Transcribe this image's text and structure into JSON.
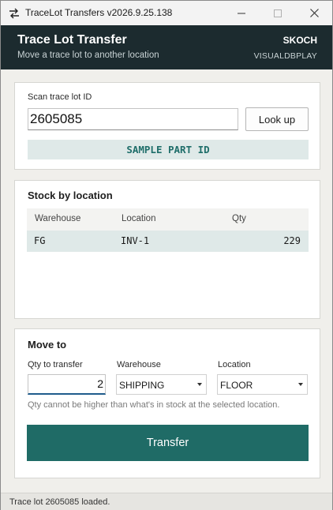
{
  "window": {
    "title": "TraceLot Transfers v2026.9.25.138",
    "app_icon": "swap-arrows-icon",
    "controls": [
      "minimize-icon",
      "maximize-icon",
      "close-icon"
    ]
  },
  "header": {
    "title": "Trace Lot Transfer",
    "subtitle": "Move a trace lot to another location",
    "user": "SKOCH",
    "database": "VISUALDBPLAY"
  },
  "scan": {
    "label": "Scan trace lot ID",
    "value": "2605085",
    "lookup_label": "Look up",
    "part_id": "SAMPLE PART ID"
  },
  "stock": {
    "title": "Stock by location",
    "columns": [
      "Warehouse",
      "Location",
      "Qty"
    ],
    "rows": [
      {
        "warehouse": "FG",
        "location": "INV-1",
        "qty": "229"
      }
    ]
  },
  "move": {
    "title": "Move to",
    "qty_label": "Qty to transfer",
    "qty_value": "2",
    "warehouse_label": "Warehouse",
    "warehouse_value": "SHIPPING",
    "location_label": "Location",
    "location_value": "FLOOR",
    "hint": "Qty cannot be higher than what's in stock at the selected location.",
    "transfer_label": "Transfer"
  },
  "status": {
    "text": "Trace lot 2605085 loaded."
  },
  "colors": {
    "header_bg": "#1c2b2f",
    "accent": "#1f6b66",
    "highlight_bg": "#dfe9e8"
  }
}
